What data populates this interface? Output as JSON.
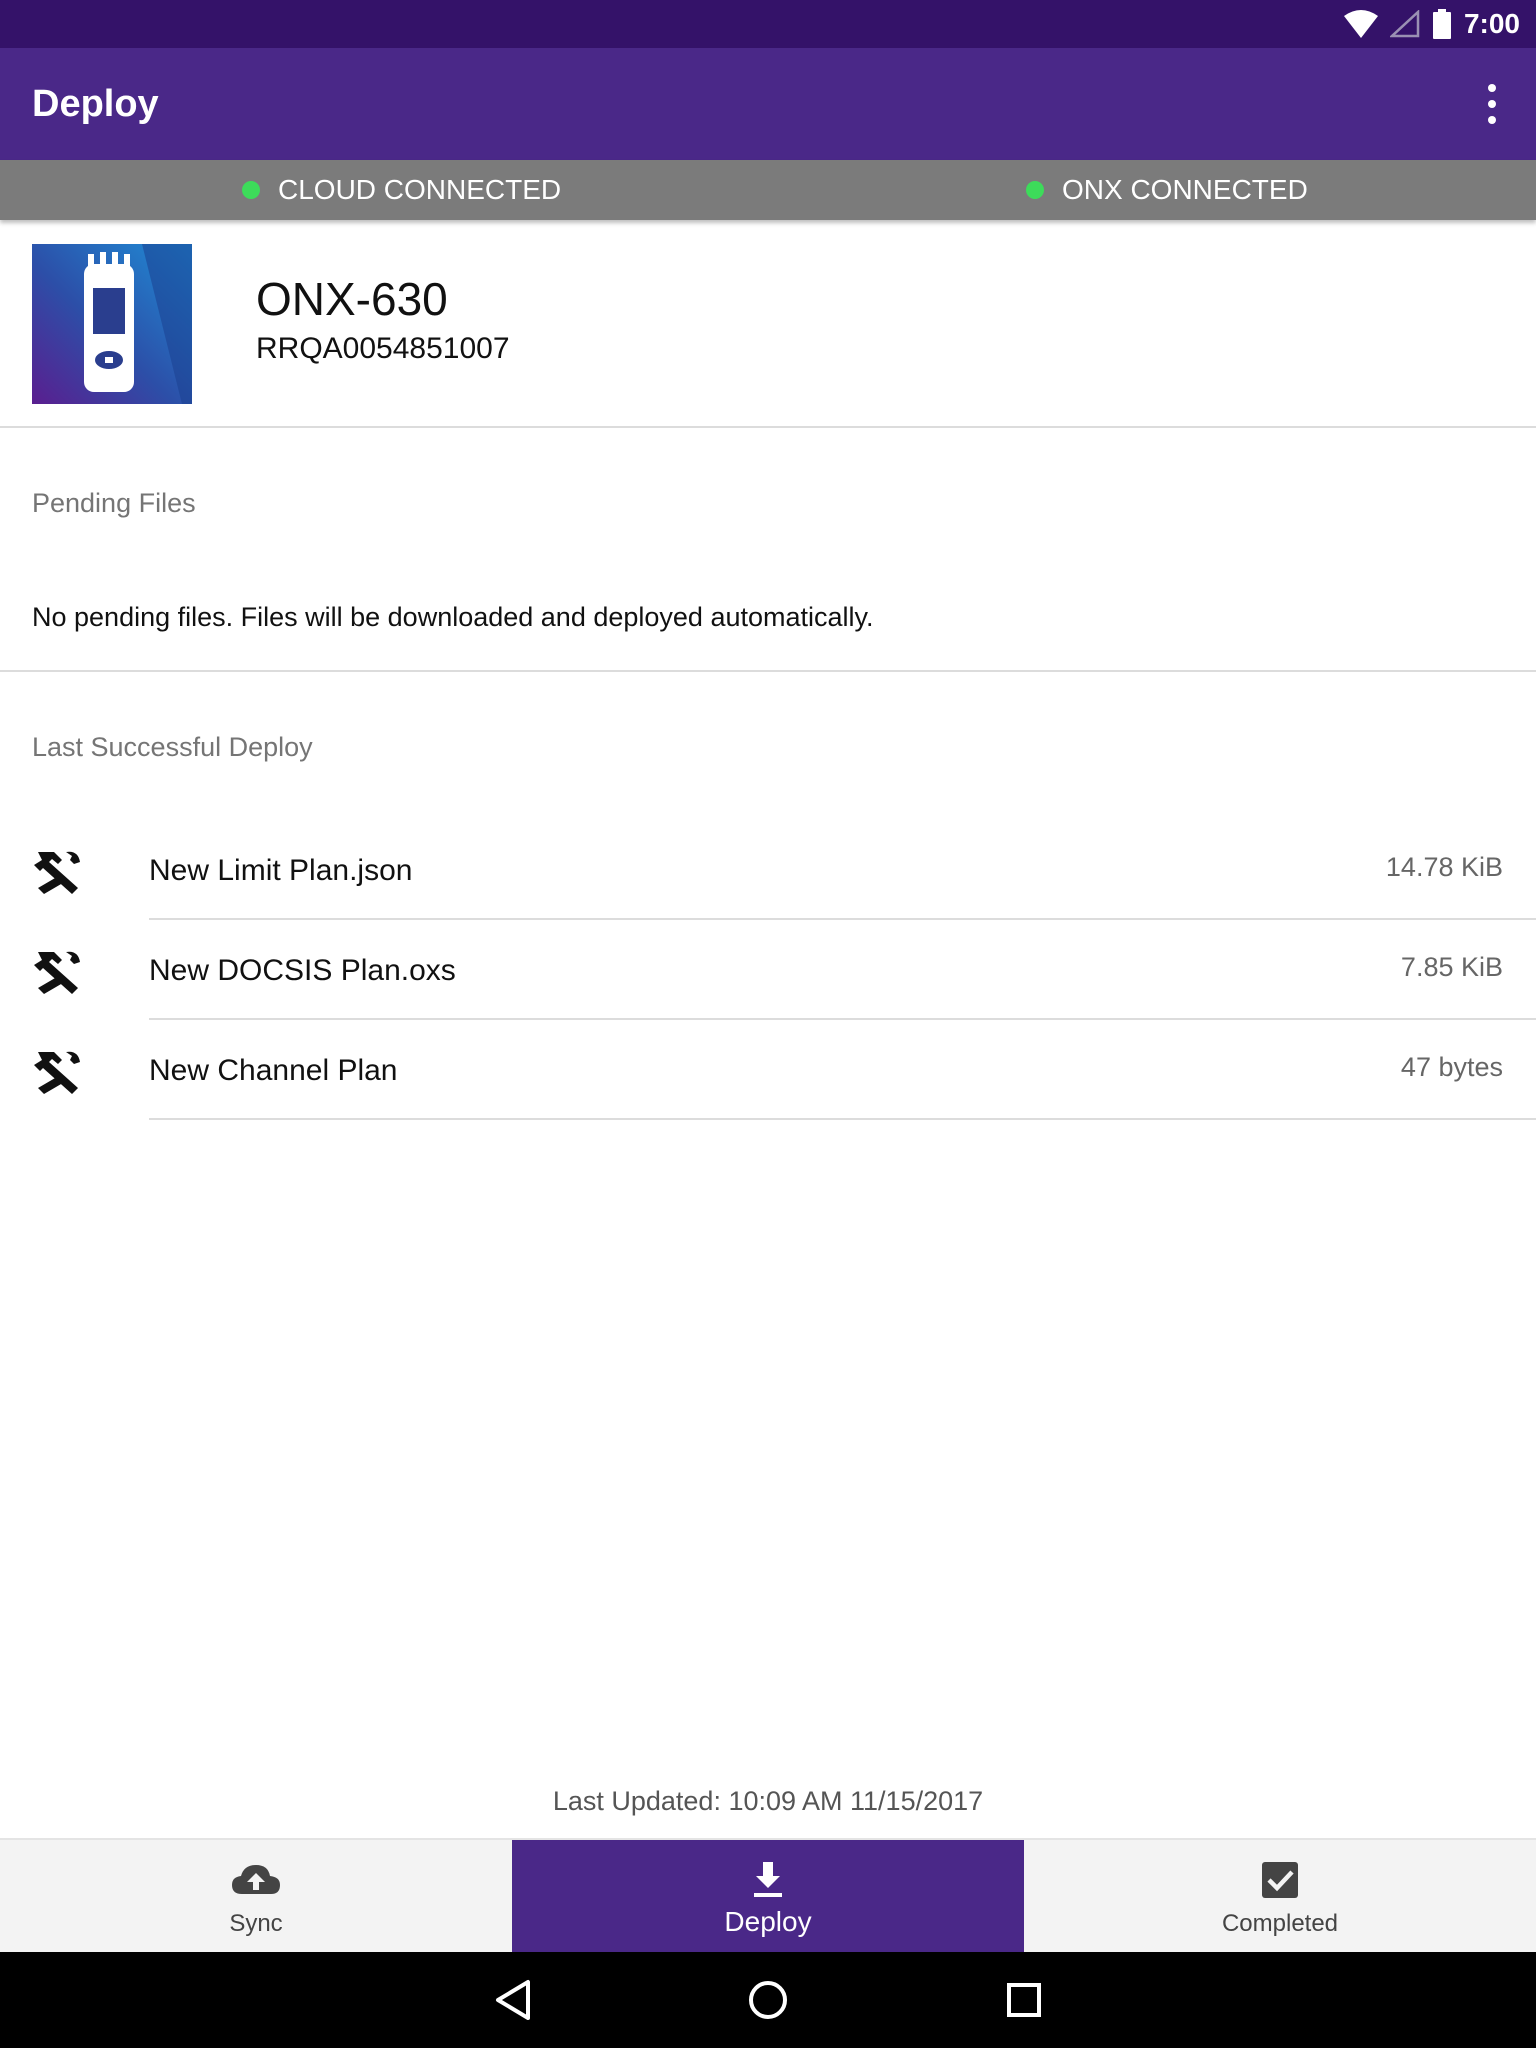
{
  "status_bar": {
    "time": "7:00",
    "icons": [
      "wifi-icon",
      "cell-signal-icon",
      "battery-icon"
    ]
  },
  "app_bar": {
    "title": "Deploy",
    "menu_icon": "more-vert-icon"
  },
  "connection": {
    "cloud": {
      "label": "CLOUD CONNECTED",
      "color": "#3ddc5a"
    },
    "onx": {
      "label": "ONX CONNECTED",
      "color": "#3ddc5a"
    }
  },
  "device": {
    "model": "ONX-630",
    "serial": "RRQA0054851007",
    "image_icon": "handheld-meter-icon"
  },
  "pending": {
    "title": "Pending Files",
    "message": "No pending files. Files will be downloaded and deployed automatically."
  },
  "last_deploy": {
    "title": "Last Successful Deploy",
    "files": [
      {
        "name": "New Limit Plan.json",
        "size": "14.78 KiB",
        "icon": "tools-icon"
      },
      {
        "name": "New DOCSIS Plan.oxs",
        "size": "7.85 KiB",
        "icon": "tools-icon"
      },
      {
        "name": "New Channel Plan",
        "size": "47 bytes",
        "icon": "tools-icon"
      }
    ]
  },
  "last_updated": "Last Updated: 10:09 AM 11/15/2017",
  "bottom_nav": {
    "tabs": [
      {
        "label": "Sync",
        "icon": "cloud-upload-icon",
        "active": false
      },
      {
        "label": "Deploy",
        "icon": "download-icon",
        "active": true
      },
      {
        "label": "Completed",
        "icon": "check-box-icon",
        "active": false
      }
    ]
  },
  "system_nav": [
    "back-icon",
    "home-icon",
    "recents-icon"
  ],
  "colors": {
    "status_bar": "#341269",
    "app_bar": "#4a2888",
    "connection_bar": "#7b7b7b",
    "active_tab": "#4a2888"
  }
}
